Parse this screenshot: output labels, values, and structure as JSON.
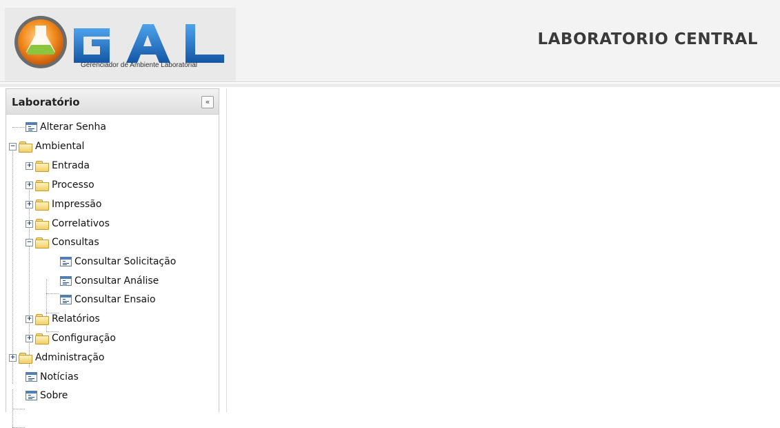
{
  "header": {
    "logo_text": "GAL",
    "logo_tagline": "Gerenciador de Ambiente Laboratorial",
    "title": "LABORATORIO CENTRAL"
  },
  "sidebar": {
    "title": "Laboratório",
    "collapse_icon": "«",
    "tree": [
      {
        "label": "Alterar Senha",
        "type": "leaf"
      },
      {
        "label": "Ambiental",
        "type": "folder",
        "expanded": true
      },
      {
        "label": "Entrada",
        "type": "folder",
        "expanded": false
      },
      {
        "label": "Processo",
        "type": "folder",
        "expanded": false
      },
      {
        "label": "Impressão",
        "type": "folder",
        "expanded": false
      },
      {
        "label": "Correlativos",
        "type": "folder",
        "expanded": false
      },
      {
        "label": "Consultas",
        "type": "folder",
        "expanded": true
      },
      {
        "label": "Consultar Solicitação",
        "type": "leaf"
      },
      {
        "label": "Consultar Análise",
        "type": "leaf"
      },
      {
        "label": "Consultar Ensaio",
        "type": "leaf"
      },
      {
        "label": "Relatórios",
        "type": "folder",
        "expanded": false
      },
      {
        "label": "Configuração",
        "type": "folder",
        "expanded": false
      },
      {
        "label": "Administração",
        "type": "folder",
        "expanded": false
      },
      {
        "label": "Notícias",
        "type": "leaf"
      },
      {
        "label": "Sobre",
        "type": "leaf"
      }
    ]
  },
  "icons": {
    "folder": "folder-icon",
    "leaf": "page-icon",
    "expand": "plus-toggle-icon",
    "collapse": "minus-toggle-icon"
  },
  "colors": {
    "logo_blue": "#1f6fc1",
    "logo_orange": "#f0841f",
    "logo_green": "#8cc63f"
  }
}
